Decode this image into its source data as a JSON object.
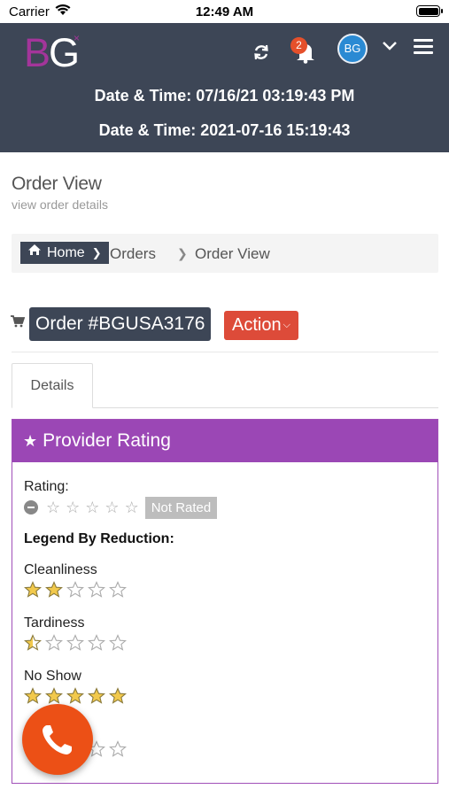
{
  "status_bar": {
    "carrier": "Carrier",
    "time": "12:49 AM"
  },
  "header": {
    "logo": "BG",
    "notification_count": "2",
    "avatar_initials": "BG",
    "datetime_1": "Date & Time: 07/16/21 03:19:43 PM",
    "datetime_2": "Date & Time: 2021-07-16 15:19:43"
  },
  "page": {
    "title": "Order View",
    "subtitle": "view order details"
  },
  "breadcrumb": {
    "home": "Home",
    "orders": "Orders",
    "current": "Order View"
  },
  "order": {
    "label": "Order #BGUSA3176",
    "action_label": "Action"
  },
  "tabs": {
    "details": "Details"
  },
  "panel": {
    "title": "Provider Rating",
    "rating_label": "Rating:",
    "not_rated": "Not Rated",
    "legend_title": "Legend By Reduction:",
    "categories": [
      {
        "label": "Cleanliness",
        "stars": 2
      },
      {
        "label": "Tardiness",
        "stars": 0.5
      },
      {
        "label": "No Show",
        "stars": 5
      },
      {
        "label": "",
        "stars": 3
      }
    ]
  },
  "colors": {
    "header_bg": "#3d4656",
    "panel_purple": "#9b47b5",
    "action_red": "#dd4b39",
    "fab_orange": "#ec5016",
    "star_gold": "#f2c94c"
  }
}
